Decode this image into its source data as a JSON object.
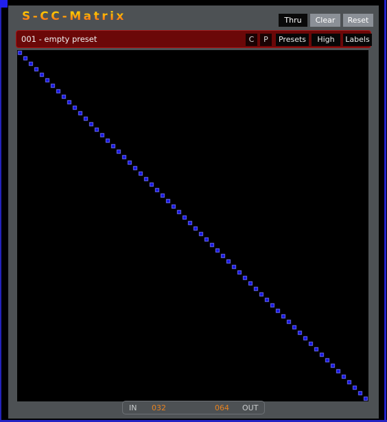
{
  "window": {
    "title": "S-CC-Matrix",
    "background_color": "#4d5154",
    "frame_color": "#2222cc",
    "matrix_background": "#000000"
  },
  "header": {
    "title": "S-CC-Matrix",
    "buttons": [
      {
        "name": "thru",
        "label": "Thru",
        "state": "active"
      },
      {
        "name": "clear",
        "label": "Clear",
        "state": "idle"
      },
      {
        "name": "reset",
        "label": "Reset",
        "state": "idle"
      }
    ]
  },
  "preset_bar": {
    "preset_label": "001 - empty preset",
    "preset_number": "001",
    "preset_name": "empty preset",
    "background_color": "#6b0808",
    "border_color": "#a81414",
    "buttons": [
      {
        "name": "copy",
        "label": "C"
      },
      {
        "name": "paste",
        "label": "P"
      },
      {
        "name": "presets",
        "label": "Presets"
      },
      {
        "name": "high",
        "label": "High"
      },
      {
        "name": "labels",
        "label": "Labels"
      }
    ]
  },
  "matrix": {
    "rows": 64,
    "cols": 64,
    "cell_size": 8,
    "cell_color": "#1414e6",
    "cell_highlight_color": "#6e6ef2",
    "background_color": "#000000",
    "active_cells_description": "identity diagonal - each input routed to the matching output",
    "active_cells": [
      [
        0,
        0
      ],
      [
        1,
        1
      ],
      [
        2,
        2
      ],
      [
        3,
        3
      ],
      [
        4,
        4
      ],
      [
        5,
        5
      ],
      [
        6,
        6
      ],
      [
        7,
        7
      ],
      [
        8,
        8
      ],
      [
        9,
        9
      ],
      [
        10,
        10
      ],
      [
        11,
        11
      ],
      [
        12,
        12
      ],
      [
        13,
        13
      ],
      [
        14,
        14
      ],
      [
        15,
        15
      ],
      [
        16,
        16
      ],
      [
        17,
        17
      ],
      [
        18,
        18
      ],
      [
        19,
        19
      ],
      [
        20,
        20
      ],
      [
        21,
        21
      ],
      [
        22,
        22
      ],
      [
        23,
        23
      ],
      [
        24,
        24
      ],
      [
        25,
        25
      ],
      [
        26,
        26
      ],
      [
        27,
        27
      ],
      [
        28,
        28
      ],
      [
        29,
        29
      ],
      [
        30,
        30
      ],
      [
        31,
        31
      ],
      [
        32,
        32
      ],
      [
        33,
        33
      ],
      [
        34,
        34
      ],
      [
        35,
        35
      ],
      [
        36,
        36
      ],
      [
        37,
        37
      ],
      [
        38,
        38
      ],
      [
        39,
        39
      ],
      [
        40,
        40
      ],
      [
        41,
        41
      ],
      [
        42,
        42
      ],
      [
        43,
        43
      ],
      [
        44,
        44
      ],
      [
        45,
        45
      ],
      [
        46,
        46
      ],
      [
        47,
        47
      ],
      [
        48,
        48
      ],
      [
        49,
        49
      ],
      [
        50,
        50
      ],
      [
        51,
        51
      ],
      [
        52,
        52
      ],
      [
        53,
        53
      ],
      [
        54,
        54
      ],
      [
        55,
        55
      ],
      [
        56,
        56
      ],
      [
        57,
        57
      ],
      [
        58,
        58
      ],
      [
        59,
        59
      ],
      [
        60,
        60
      ],
      [
        61,
        61
      ],
      [
        62,
        62
      ],
      [
        63,
        63
      ]
    ]
  },
  "status_bar": {
    "in_label": "IN",
    "in_value": "032",
    "out_value": "064",
    "out_label": "OUT",
    "value_color": "#e8821e",
    "label_color": "#c9ccce"
  }
}
